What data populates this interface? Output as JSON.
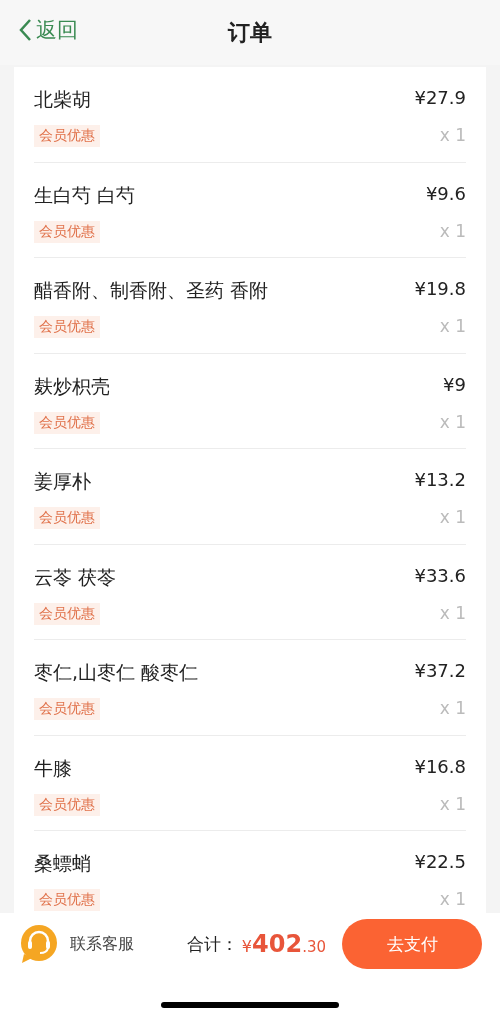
{
  "nav": {
    "back": "返回",
    "title": "订单"
  },
  "items": [
    {
      "name": "北柴胡",
      "price": "¥27.9",
      "badge": "会员优惠",
      "qty": "x 1"
    },
    {
      "name": "生白芍 白芍",
      "price": "¥9.6",
      "badge": "会员优惠",
      "qty": "x 1"
    },
    {
      "name": "醋香附、制香附、圣药 香附",
      "price": "¥19.8",
      "badge": "会员优惠",
      "qty": "x 1"
    },
    {
      "name": "麸炒枳壳",
      "price": "¥9",
      "badge": "会员优惠",
      "qty": "x 1"
    },
    {
      "name": "姜厚朴",
      "price": "¥13.2",
      "badge": "会员优惠",
      "qty": "x 1"
    },
    {
      "name": "云苓 茯苓",
      "price": "¥33.6",
      "badge": "会员优惠",
      "qty": "x 1"
    },
    {
      "name": "枣仁,山枣仁 酸枣仁",
      "price": "¥37.2",
      "badge": "会员优惠",
      "qty": "x 1"
    },
    {
      "name": "牛膝",
      "price": "¥16.8",
      "badge": "会员优惠",
      "qty": "x 1"
    },
    {
      "name": "桑螵蛸",
      "price": "¥22.5",
      "badge": "会员优惠",
      "qty": "x 1"
    }
  ],
  "footer": {
    "service": "联系客服",
    "total_label": "合计：",
    "currency": "¥",
    "total_int": "402",
    "total_dec": ".30",
    "pay": "去支付"
  }
}
